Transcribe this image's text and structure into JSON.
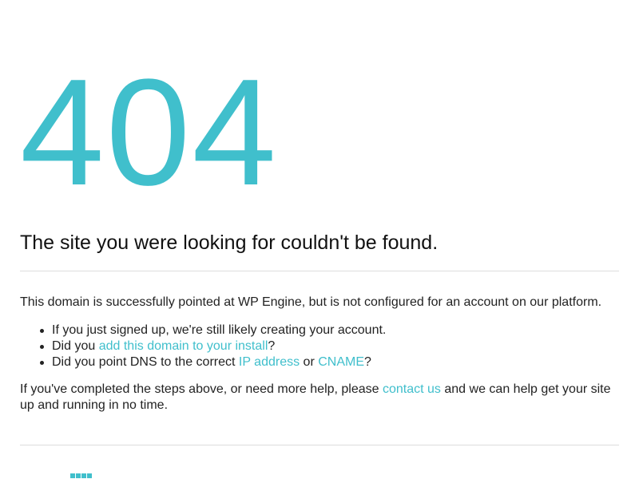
{
  "error": {
    "code": "404",
    "headline": "The site you were looking for couldn't be found."
  },
  "intro": "This domain is successfully pointed at WP Engine, but is not configured for an account on our platform.",
  "checklist": {
    "item1": "If you just signed up, we're still likely creating your account.",
    "item2": {
      "before": "Did you ",
      "link": "add this domain to your install",
      "after": "?"
    },
    "item3": {
      "before": "Did you point DNS to the correct ",
      "link1": "IP address",
      "middle": " or ",
      "link2": "CNAME",
      "after": "?"
    }
  },
  "help": {
    "before": "If you've completed the steps above, or need more help, please ",
    "link": "contact us",
    "after": " and we can help get your site up and running in no time."
  },
  "logo": {
    "icon": "wp-engine-logo-icon"
  },
  "colors": {
    "accent": "#40bfcc",
    "text": "#222222",
    "divider": "#dddddd"
  }
}
